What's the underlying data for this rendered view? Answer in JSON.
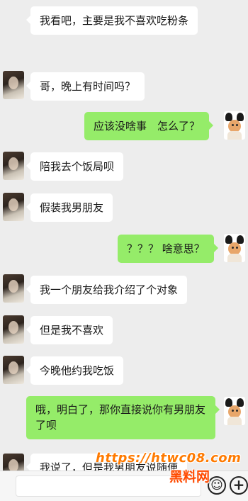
{
  "messages": [
    {
      "side": "in",
      "text": "我看吧，主要是我不喜欢吃粉条",
      "avatar": "none"
    },
    {
      "side": "in",
      "text": "哥，晚上有时间吗？",
      "avatar": "friend-avatar"
    },
    {
      "side": "out",
      "text": "应该没啥事　怎么了？",
      "avatar": "me-avatar"
    },
    {
      "side": "in",
      "text": "陪我去个饭局呗",
      "avatar": "friend-avatar"
    },
    {
      "side": "in",
      "text": "假装我男朋友",
      "avatar": "friend-avatar"
    },
    {
      "side": "out",
      "text": "？？？ 啥意思？",
      "avatar": "me-avatar"
    },
    {
      "side": "in",
      "text": "我一个朋友给我介绍了个对象",
      "avatar": "friend-avatar"
    },
    {
      "side": "in",
      "text": "但是我不喜欢",
      "avatar": "friend-avatar"
    },
    {
      "side": "in",
      "text": "今晚他约我吃饭",
      "avatar": "friend-avatar"
    },
    {
      "side": "out",
      "text": "哦，明白了，那你直接说你有男朋友了呗",
      "avatar": "me-avatar"
    },
    {
      "side": "in",
      "text": "我说了，但是我男朋友说随便",
      "avatar": "friend-avatar"
    }
  ],
  "watermark": {
    "url": "https://htwc08.com",
    "name": "黑料网"
  },
  "input_bar": {
    "emoji_icon": "smile-icon",
    "more_icon": "plus-icon"
  }
}
